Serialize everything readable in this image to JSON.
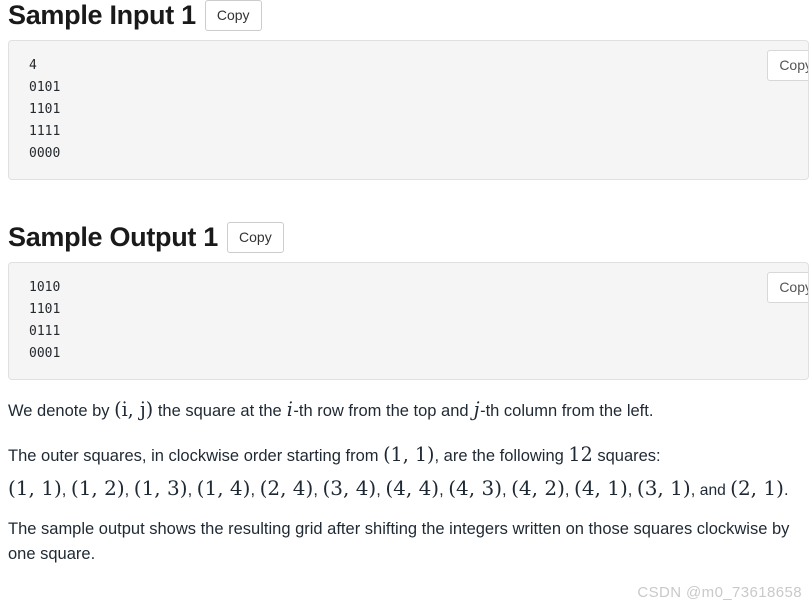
{
  "sections": [
    {
      "title": "Sample Input 1",
      "copy_label": "Copy",
      "inner_copy_label": "Copy",
      "code": "4\n0101\n1101\n1111\n0000"
    },
    {
      "title": "Sample Output 1",
      "copy_label": "Copy",
      "inner_copy_label": "Copy",
      "code": "1010\n1101\n0111\n0001"
    }
  ],
  "explanation": {
    "p1": {
      "a": "We denote by ",
      "tuple": "(i, j)",
      "b": " the square at the ",
      "var_i": "i",
      "c": "-th row from the top and ",
      "var_j": "j",
      "d": "-th column from the left."
    },
    "p2": {
      "a": "The outer squares, in clockwise order starting from ",
      "start_tuple": "(1, 1)",
      "b": ", are the following ",
      "count": "12",
      "c": " squares:"
    },
    "p3": {
      "squares": [
        "(1, 1)",
        "(1, 2)",
        "(1, 3)",
        "(1, 4)",
        "(2, 4)",
        "(3, 4)",
        "(4, 4)",
        "(4, 3)",
        "(4, 2)",
        "(4, 1)",
        "(3, 1)",
        "(2, 1)"
      ],
      "separator": ", ",
      "and_word": "and ",
      "terminator": "."
    },
    "p4": "The sample output shows the resulting grid after shifting the integers written on those squares clockwise by one square."
  },
  "watermark": "CSDN @m0_73618658",
  "colors": {
    "code_background": "#f5f5f5",
    "code_border": "#e0e0e0",
    "text": "#1f2933",
    "heading": "#1a1a1a",
    "watermark": "#c9c9c9",
    "button_border": "#cccccc"
  }
}
